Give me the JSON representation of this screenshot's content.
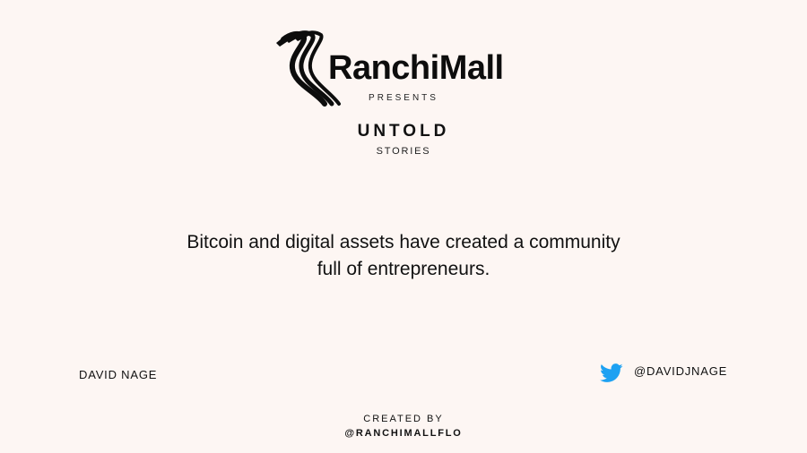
{
  "brand": {
    "name": "RanchiMall",
    "logo_icon": "ranchimall-logo-icon"
  },
  "header": {
    "presents": "PRESENTS",
    "title": "UNTOLD",
    "subtitle": "STORIES"
  },
  "quote": {
    "line1": "Bitcoin and digital assets have created a community",
    "line2": "full of entrepreneurs."
  },
  "author": {
    "name": "DAVID NAGE",
    "twitter_icon": "twitter-icon",
    "twitter_handle": "@DAVIDJNAGE"
  },
  "footer": {
    "created_by": "CREATED BY",
    "handle": "@RANCHIMALLFLO"
  },
  "colors": {
    "background": "#fdf6f3",
    "text": "#111111",
    "twitter": "#1da1f2"
  }
}
